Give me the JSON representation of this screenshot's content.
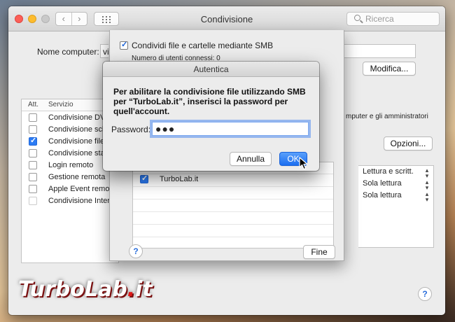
{
  "window": {
    "title": "Condivisione",
    "nav_back": "‹",
    "nav_forward": "›",
    "search_placeholder": "Ricerca"
  },
  "computer_name": {
    "label": "Nome computer:",
    "value": "vi",
    "edit_button": "Modifica..."
  },
  "services": {
    "header_on": "Att.",
    "header_service": "Servizio",
    "items": [
      {
        "label": "Condivisione DVD",
        "on": false
      },
      {
        "label": "Condivisione schermo",
        "on": false
      },
      {
        "label": "Condivisione file",
        "on": true
      },
      {
        "label": "Condivisione stampante",
        "on": false
      },
      {
        "label": "Login remoto",
        "on": false
      },
      {
        "label": "Gestione remota",
        "on": false
      },
      {
        "label": "Apple Event remoti",
        "on": false
      },
      {
        "label": "Condivisione Internet",
        "on": false
      }
    ]
  },
  "right": {
    "access_note": "mputer e gli amministratori",
    "options_button": "Opzioni...",
    "permissions": [
      "Lettura e scritt.",
      "Sola lettura",
      "Sola lettura"
    ]
  },
  "smb_sheet": {
    "smb_checkbox_label": "Condividi file e cartelle mediante SMB",
    "users_connected": "Numero di utenti connessi: 0",
    "account_name": "TurboLab.it",
    "done_button": "Fine",
    "help": "?"
  },
  "auth_dialog": {
    "title": "Autentica",
    "message": "Per abilitare la condivisione file utilizzando SMB per “TurboLab.it”, inserisci la password per quell'account.",
    "password_label": "Password:",
    "password_value": "●●●",
    "cancel_button": "Annulla",
    "ok_button": "OK"
  },
  "window_help": "?",
  "watermark": {
    "name": "TurboLab",
    "dot": ".",
    "tld": "it"
  }
}
